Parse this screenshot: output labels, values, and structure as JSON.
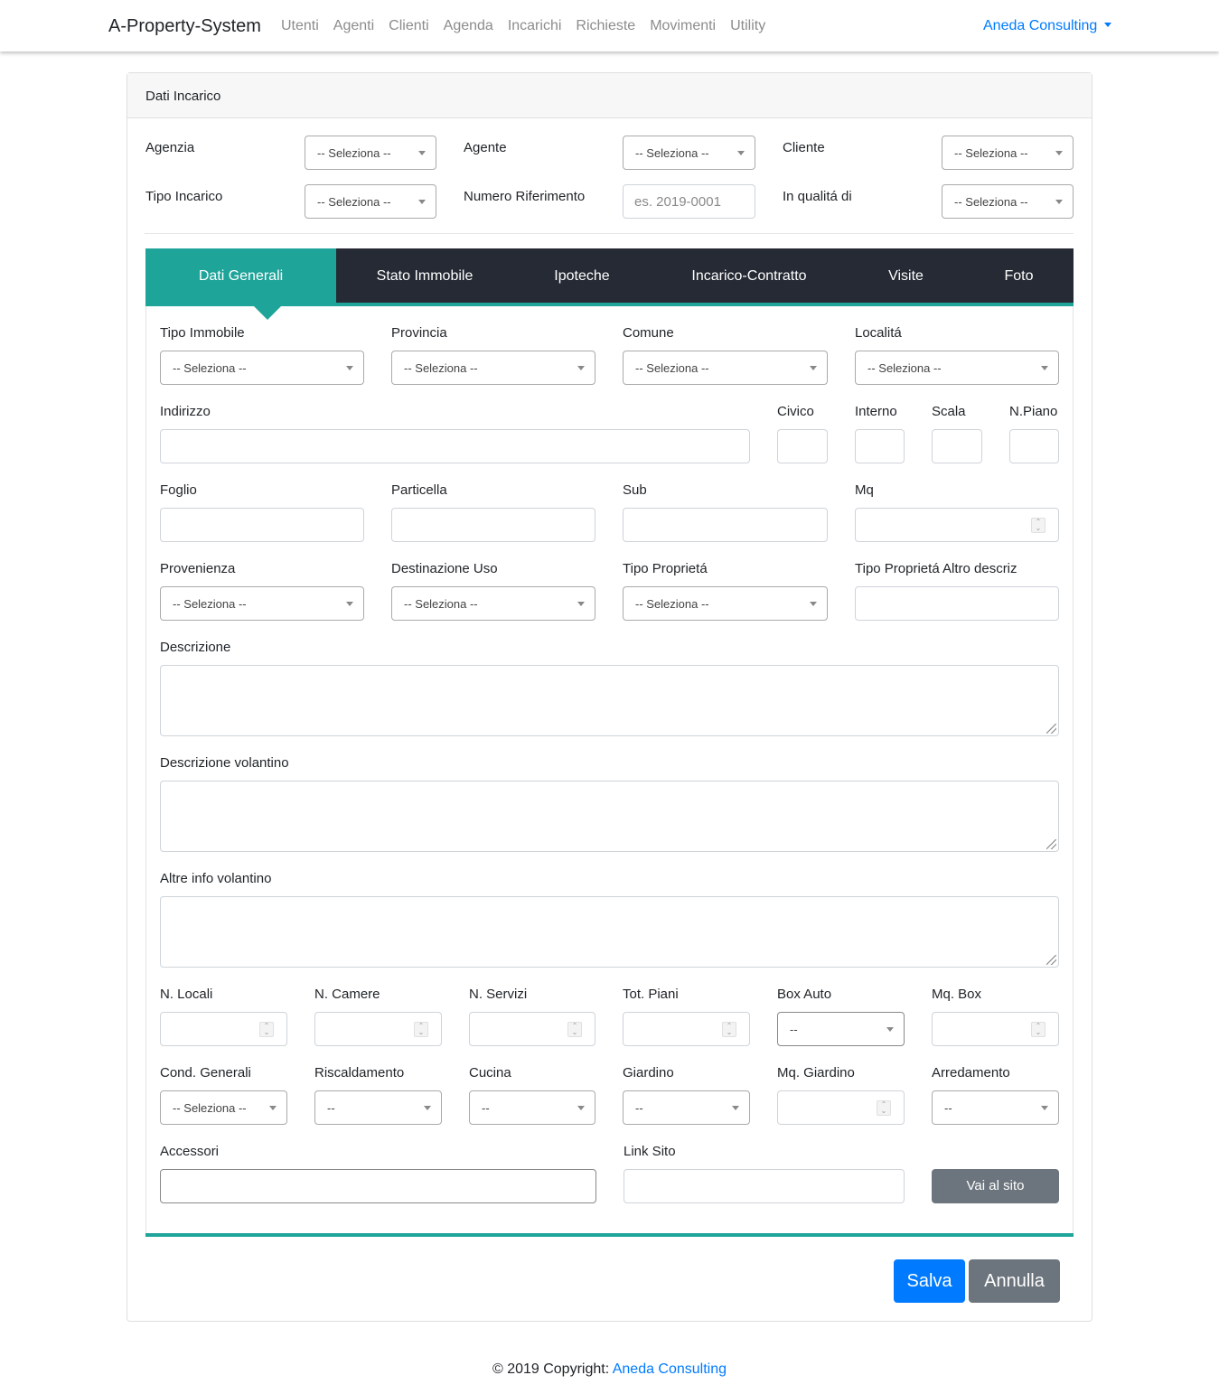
{
  "nav": {
    "brand": "A-Property-System",
    "links": [
      "Utenti",
      "Agenti",
      "Clienti",
      "Agenda",
      "Incarichi",
      "Richieste",
      "Movimenti",
      "Utility"
    ],
    "user": "Aneda Consulting"
  },
  "card": {
    "title": "Dati Incarico",
    "agenzia_label": "Agenzia",
    "agente_label": "Agente",
    "cliente_label": "Cliente",
    "tipo_incarico_label": "Tipo Incarico",
    "numero_rif_label": "Numero Riferimento",
    "numero_rif_placeholder": "es. 2019-0001",
    "qualita_label": "In qualitá di",
    "select_placeholder": "-- Seleziona --"
  },
  "tabs": [
    "Dati Generali",
    "Stato Immobile",
    "Ipoteche",
    "Incarico-Contratto",
    "Visite",
    "Foto"
  ],
  "form": {
    "tipo_immobile": "Tipo Immobile",
    "provincia": "Provincia",
    "comune": "Comune",
    "localita": "Localitá",
    "indirizzo": "Indirizzo",
    "civico": "Civico",
    "interno": "Interno",
    "scala": "Scala",
    "npiano": "N.Piano",
    "foglio": "Foglio",
    "particella": "Particella",
    "sub": "Sub",
    "mq": "Mq",
    "provenienza": "Provenienza",
    "destinazione_uso": "Destinazione Uso",
    "tipo_proprieta": "Tipo Proprietá",
    "tipo_proprieta_altro": "Tipo Proprietá Altro descriz",
    "descrizione": "Descrizione",
    "descrizione_volantino": "Descrizione volantino",
    "altre_info": "Altre info volantino",
    "n_locali": "N. Locali",
    "n_camere": "N. Camere",
    "n_servizi": "N. Servizi",
    "tot_piani": "Tot. Piani",
    "box_auto": "Box Auto",
    "mq_box": "Mq. Box",
    "cond_generali": "Cond. Generali",
    "riscaldamento": "Riscaldamento",
    "cucina": "Cucina",
    "giardino": "Giardino",
    "mq_giardino": "Mq. Giardino",
    "arredamento": "Arredamento",
    "accessori": "Accessori",
    "link_sito": "Link Sito",
    "seleziona": "-- Seleziona --",
    "dash": "--"
  },
  "buttons": {
    "vai_al_sito": "Vai al sito",
    "salva": "Salva",
    "annulla": "Annulla"
  },
  "footer": {
    "text": "© 2019 Copyright: ",
    "link": "Aneda Consulting"
  },
  "colors": {
    "accent": "#1fa499",
    "tabs_bg": "#252a34",
    "primary": "#007bff",
    "secondary": "#6c757d"
  }
}
